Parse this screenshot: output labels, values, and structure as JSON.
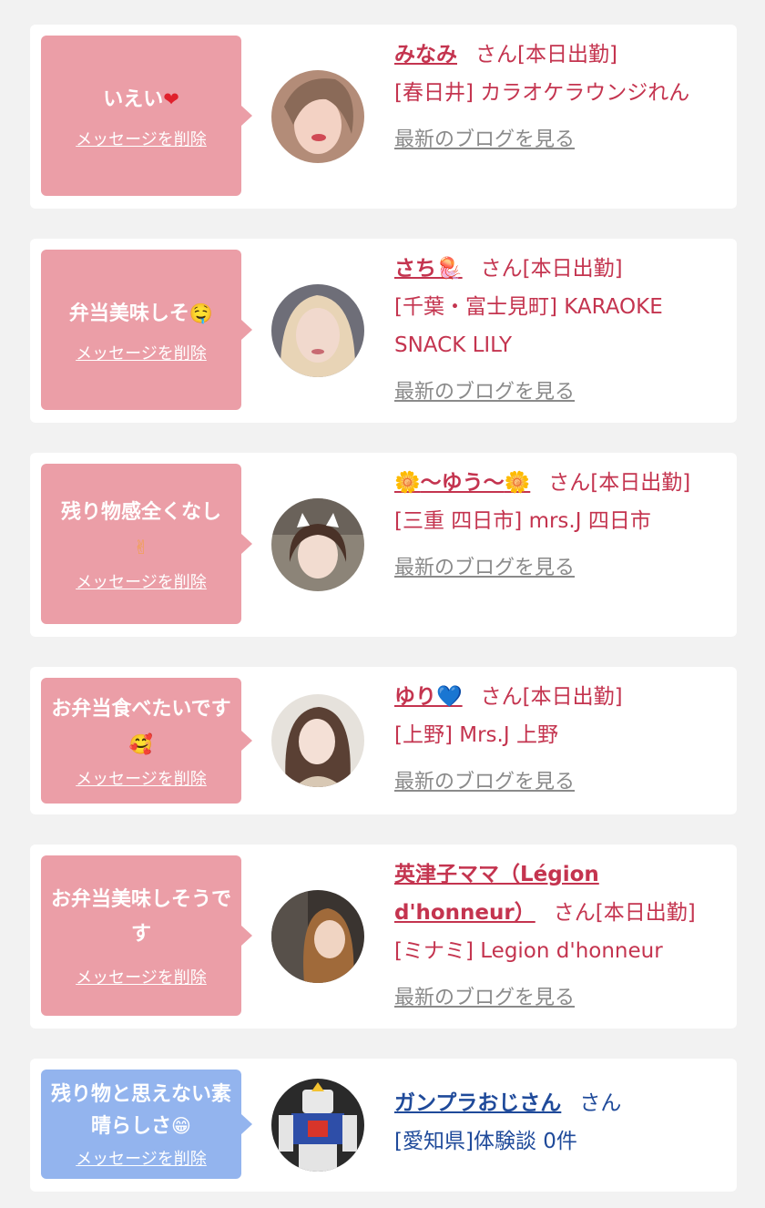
{
  "cards": [
    {
      "bubble_text": "いえい",
      "bubble_emoji": "❤",
      "delete_label": "メッセージを削除",
      "name": "みなみ",
      "honorific": "さん[本日出勤]",
      "location": "[春日井] カラオケラウンジれん",
      "blog_label": "最新のブログを見る",
      "avatar_icon": "avatar-photo"
    },
    {
      "bubble_text": "弁当美味しそ",
      "bubble_emoji": "🤤",
      "delete_label": "メッセージを削除",
      "name": "さち",
      "name_emoji": "🪼",
      "honorific": "さん[本日出勤]",
      "location": "[千葉・富士見町] KARAOKE SNACK LILY",
      "blog_label": "最新のブログを見る",
      "avatar_icon": "avatar-photo"
    },
    {
      "bubble_text": "残り物感全くなし",
      "bubble_emoji": "✌",
      "delete_label": "メッセージを削除",
      "name_prefix": "🌼",
      "name": "〜ゆう〜",
      "name_emoji": "🌼",
      "honorific": "さん[本日出勤]",
      "location": "[三重 四日市] mrs.J 四日市",
      "blog_label": "最新のブログを見る",
      "avatar_icon": "avatar-photo"
    },
    {
      "bubble_text": "お弁当食べたいです",
      "bubble_emoji": "🥰",
      "delete_label": "メッセージを削除",
      "name": "ゆり",
      "name_emoji": "💙",
      "honorific": "さん[本日出勤]",
      "location": "[上野] Mrs.J 上野",
      "blog_label": "最新のブログを見る",
      "avatar_icon": "avatar-photo"
    },
    {
      "bubble_text": "お弁当美味しそうです",
      "delete_label": "メッセージを削除",
      "name": "英津子ママ（Légion d'honneur）",
      "honorific": "さん[本日出勤]",
      "location": "[ミナミ] Legion d'honneur",
      "blog_label": "最新のブログを見る",
      "avatar_icon": "avatar-photo"
    },
    {
      "bubble_text": "残り物と思えない素晴らしさ",
      "bubble_emoji": "😁",
      "delete_label": "メッセージを削除",
      "name": "ガンプラおじさん",
      "honorific": "さん",
      "location": "[愛知県]体験談 0件",
      "avatar_icon": "gundam-model-photo"
    }
  ],
  "colors": {
    "bubble_pink": "#eb9ea7",
    "bubble_blue": "#93b4ee",
    "name_pink": "#c4344f",
    "name_blue": "#1f4a9a",
    "blog_gray": "#8a8a8a"
  }
}
